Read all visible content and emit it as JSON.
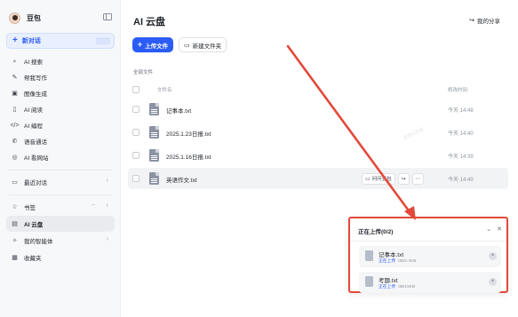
{
  "sidebar": {
    "user_name": "豆包",
    "new_chat_label": "新对话",
    "items": [
      {
        "label": "AI 搜索",
        "icon": "search-icon"
      },
      {
        "label": "帮我写作",
        "icon": "pen-icon"
      },
      {
        "label": "图像生成",
        "icon": "image-icon"
      },
      {
        "label": "AI 阅读",
        "icon": "book-icon"
      },
      {
        "label": "AI 编程",
        "icon": "code-icon"
      },
      {
        "label": "语音通话",
        "icon": "phone-icon"
      },
      {
        "label": "AI 看网站",
        "icon": "globe-icon"
      }
    ],
    "recent_label": "最近对话",
    "bookmark_label": "书签",
    "cloud_label": "AI 云盘",
    "agents_label": "我的智能体",
    "favorites_label": "收藏夹"
  },
  "header": {
    "title": "AI 云盘",
    "share_label": "我的分享"
  },
  "toolbar": {
    "upload_label": "上传文件",
    "new_folder_label": "新建文件夹"
  },
  "breadcrumb": "全部文件",
  "table": {
    "col_name": "文件名",
    "col_time": "修改时间",
    "rows": [
      {
        "name": "记事本.txt",
        "time": "今天 14:48"
      },
      {
        "name": "2025.1.23日报.txt",
        "time": "今天 14:40"
      },
      {
        "name": "2025.1.16日报.txt",
        "time": "今天 14:39"
      },
      {
        "name": "英语作文.txt",
        "time": "今天 14:40"
      }
    ],
    "hover_action_ask": "问问豆包"
  },
  "watermark": "豆包AI生成",
  "upload_panel": {
    "title": "正在上传(0/2)",
    "items": [
      {
        "name": "记事本.txt",
        "status": "正在上传",
        "size": "0B/2.4KB"
      },
      {
        "name": "考题.txt",
        "status": "正在上传",
        "size": "0B/15KB"
      }
    ]
  },
  "colors": {
    "accent": "#2b5cf6",
    "annotation": "#e2493a"
  }
}
